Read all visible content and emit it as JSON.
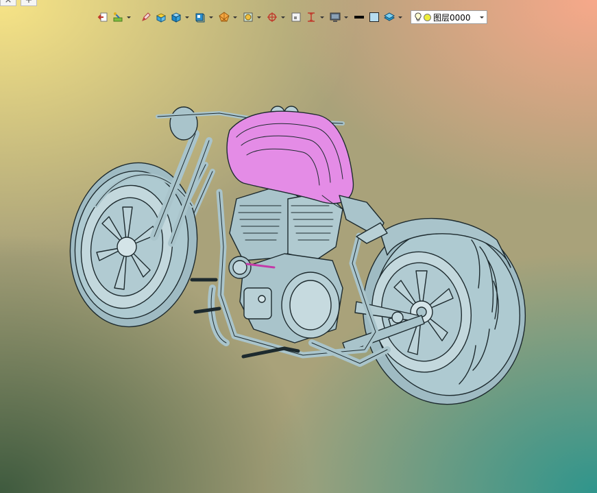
{
  "tabs": {
    "close_glyph": "×",
    "add_glyph": "+"
  },
  "toolbar": {
    "buttons": [
      "exit-sketch-icon",
      "sketch-settings-icon",
      "pencil-icon",
      "box-face-icon",
      "shaded-cube-icon",
      "view-cube-icon",
      "render-mode-icon",
      "snap-icon",
      "pivot-icon",
      "frame-icon",
      "dimension-icon",
      "display-icon",
      "line-color-icon",
      "fill-color-icon",
      "layers-icon"
    ],
    "layer_combo": {
      "value": "图层0000"
    }
  },
  "colors": {
    "model_metal": "#a9c4cb",
    "model_tank": "#e48ce6",
    "outline": "#1d2a2e",
    "bg_top_left": "#f7e486",
    "bg_top_right": "#f7a88a",
    "bg_bottom_right": "#2f958c",
    "bg_bottom_left": "#3e5a3e"
  }
}
